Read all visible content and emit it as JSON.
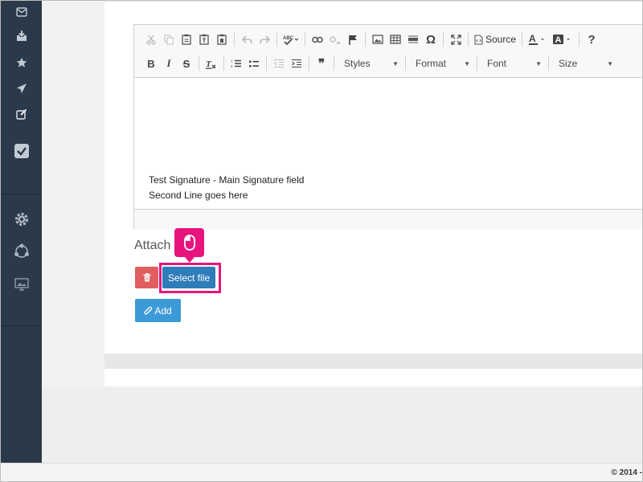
{
  "sidebar": {
    "items": [
      {
        "icon": "envelope-icon"
      },
      {
        "icon": "inbox-download-icon"
      },
      {
        "icon": "star-icon"
      },
      {
        "icon": "paper-plane-icon"
      },
      {
        "icon": "compose-icon"
      },
      {
        "icon": "check-square-icon"
      },
      {
        "icon": "gear-icon"
      },
      {
        "icon": "network-icon"
      },
      {
        "icon": "monitor-image-icon"
      }
    ]
  },
  "editor": {
    "toolbar": {
      "source_label": "Source",
      "styles_label": "Styles",
      "format_label": "Format",
      "font_label": "Font",
      "size_label": "Size",
      "help_label": "?",
      "quote_label": "❞"
    },
    "content": {
      "line1": "Test Signature - Main Signature field",
      "line2": "Second Line goes here"
    }
  },
  "attach": {
    "label": "Attach",
    "select_file_label": "Select file",
    "add_label": "Add"
  },
  "footer": {
    "copyright": "© 2014 -"
  },
  "colors": {
    "sidebar_bg": "#2b3a4a",
    "delete_button": "#e05d60",
    "select_button": "#2e7cb8",
    "add_button": "#3d9ad8",
    "highlight": "#e8147e"
  }
}
